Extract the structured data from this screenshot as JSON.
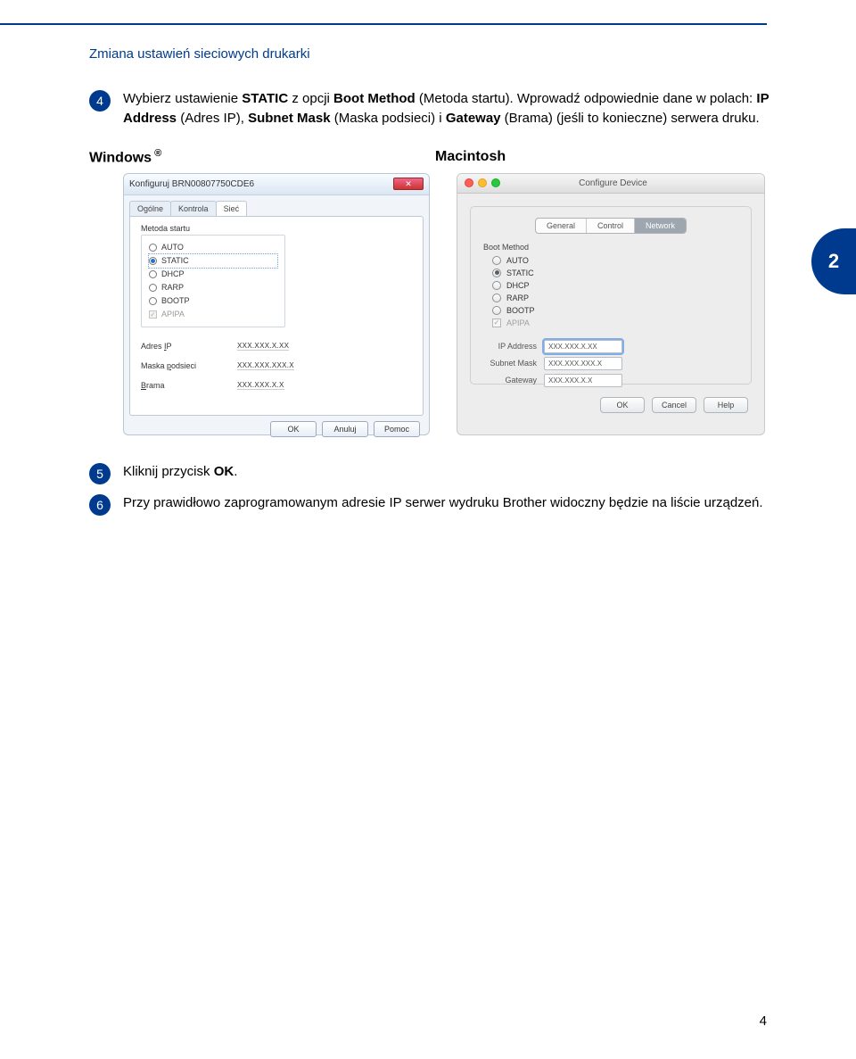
{
  "chapter_header": "Zmiana ustawień sieciowych drukarki",
  "side_tab": "2",
  "page_number": "4",
  "step4": {
    "num": "4",
    "text_prefix": "Wybierz ustawienie ",
    "static": "STATIC",
    "text_mid1": " z opcji ",
    "boot_method": "Boot Method",
    "text_mid2": " (Metoda startu). Wprowadź odpowiednie dane w polach: ",
    "ip_address": "IP Address",
    "ip_address_paren": " (Adres IP), ",
    "subnet": "Subnet Mask",
    "subnet_paren": " (Maska podsieci) i ",
    "gateway": "Gateway",
    "gateway_paren": " (Brama) (jeśli to konieczne) serwera druku."
  },
  "os": {
    "windows": "Windows",
    "reg": " ®",
    "mac": "Macintosh"
  },
  "win": {
    "title": "Konfiguruj BRN00807750CDE6",
    "close": "✕",
    "tabs": {
      "general": "Ogólne",
      "control": "Kontrola",
      "network": "Sieć"
    },
    "method_label": "Metoda startu",
    "opts": {
      "auto": "AUTO",
      "static": "STATIC",
      "dhcp": "DHCP",
      "rarp": "RARP",
      "bootp": "BOOTP",
      "apipa": "APIPA"
    },
    "ip_label": "Adres IP",
    "mask_label": "Maska podsieci",
    "gw_label": "Brama",
    "ip_val": "XXX.XXX.X.XX",
    "mask_val": "XXX.XXX.XXX.X",
    "gw_val": "XXX.XXX.X.X",
    "ok": "OK",
    "cancel": "Anuluj",
    "help": "Pomoc"
  },
  "mac": {
    "title": "Configure Device",
    "seg": {
      "general": "General",
      "control": "Control",
      "network": "Network"
    },
    "method_label": "Boot Method",
    "opts": {
      "auto": "AUTO",
      "static": "STATIC",
      "dhcp": "DHCP",
      "rarp": "RARP",
      "bootp": "BOOTP",
      "apipa": "APIPA"
    },
    "ip_label": "IP Address",
    "mask_label": "Subnet Mask",
    "gw_label": "Gateway",
    "ip_val": "XXX.XXX.X.XX",
    "mask_val": "XXX.XXX.XXX.X",
    "gw_val": "XXX.XXX.X.X",
    "ok": "OK",
    "cancel": "Cancel",
    "help": "Help"
  },
  "step5": {
    "num": "5",
    "prefix": "Kliknij przycisk ",
    "ok": "OK",
    "suffix": "."
  },
  "step6": {
    "num": "6",
    "text": "Przy prawidłowo zaprogramowanym adresie IP serwer wydruku Brother widoczny będzie na liście urządzeń."
  }
}
